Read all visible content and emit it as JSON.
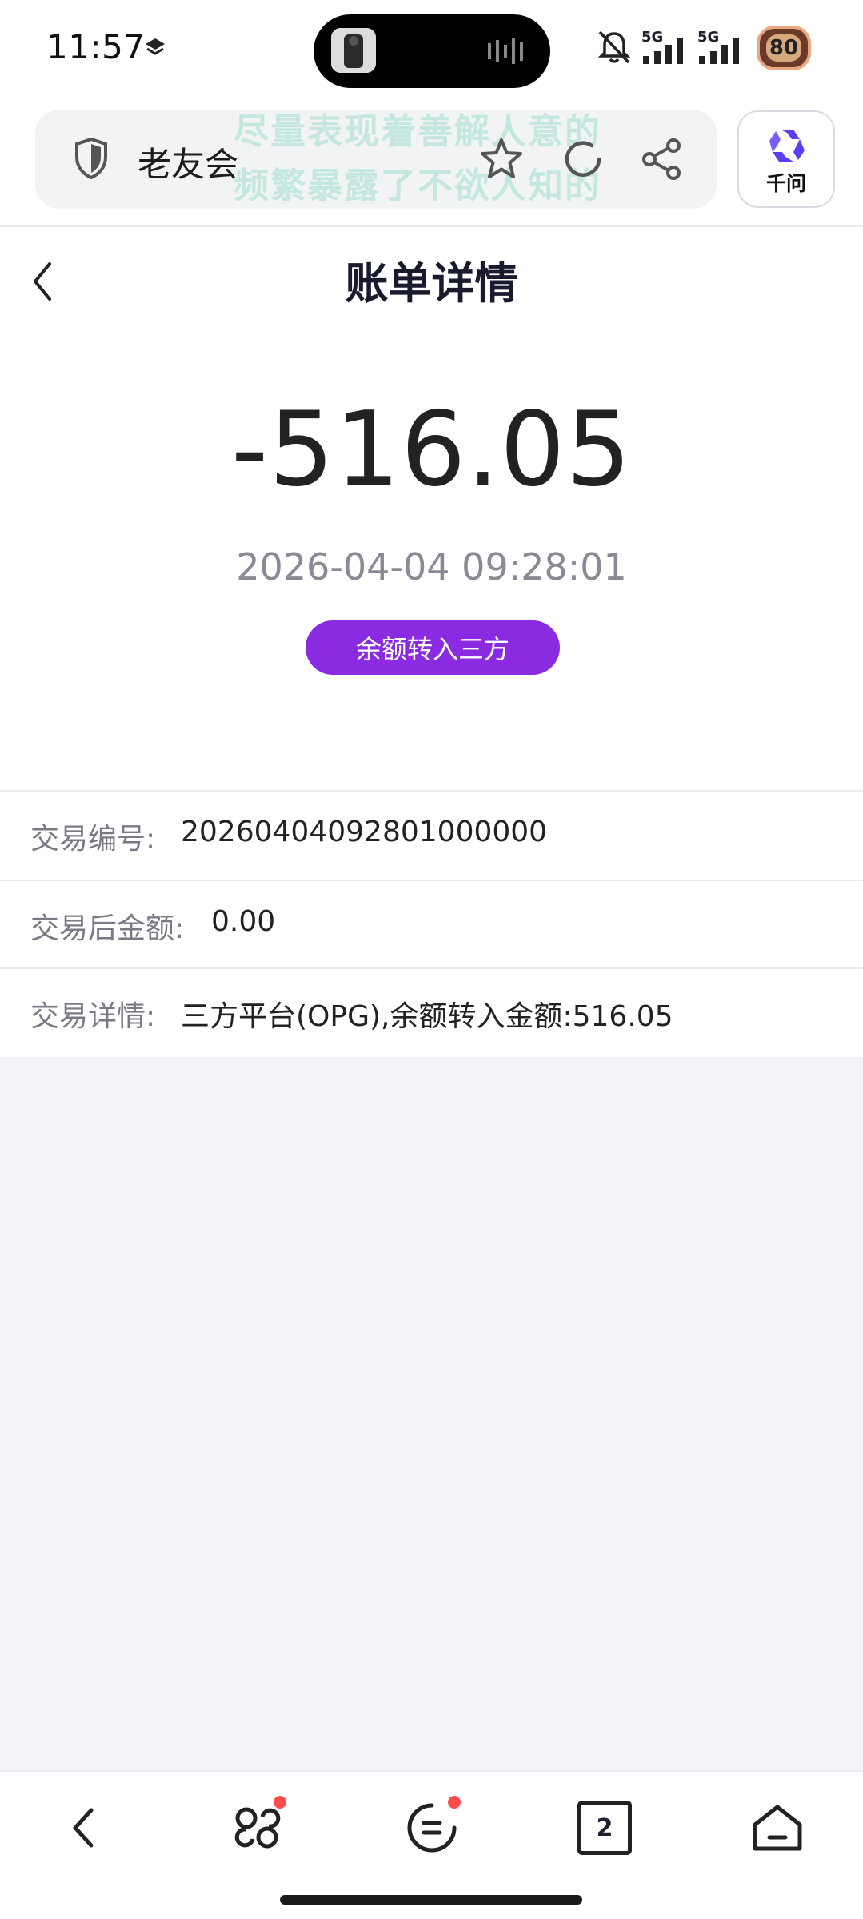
{
  "status_bar": {
    "time": "11:57",
    "network_1": "5G",
    "network_2": "5G",
    "battery": "80"
  },
  "browser": {
    "site_name": "老友会",
    "assistant_label": "千问",
    "watermark_line1": "尽量表现着善解人意的",
    "watermark_line2": "频繁暴露了不欲人知的"
  },
  "page": {
    "title": "账单详情"
  },
  "bill": {
    "amount": "-516.05",
    "datetime": "2026-04-04 09:28:01",
    "type_badge": "余额转入三方",
    "badge_color": "#8a2be2"
  },
  "details": [
    {
      "label": "交易编号:",
      "value": "20260404092801000000"
    },
    {
      "label": "交易后金额:",
      "value": "0.00"
    },
    {
      "label": "交易详情:",
      "value": "三方平台(OPG),余额转入金额:516.05"
    }
  ],
  "bottom_nav": {
    "tab_count": "2",
    "icons": [
      "back-icon",
      "discover-icon",
      "menu-icon",
      "tabs-icon",
      "home-icon"
    ]
  }
}
